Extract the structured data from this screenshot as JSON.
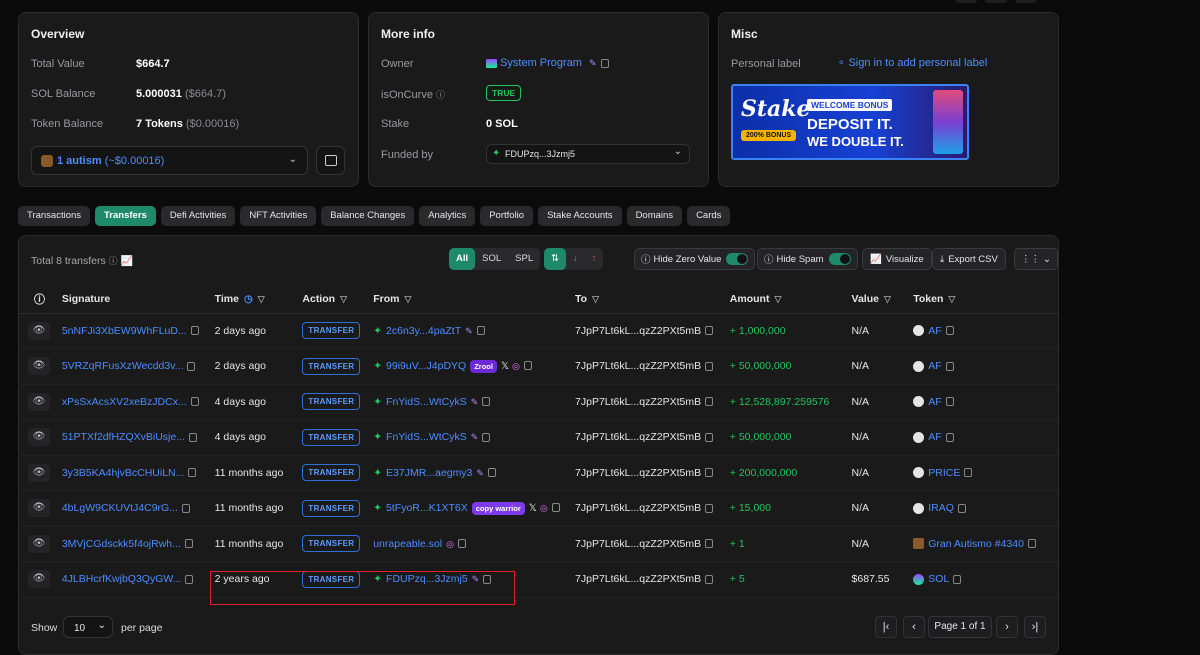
{
  "overview": {
    "title": "Overview",
    "total_value_label": "Total Value",
    "total_value": "$664.7",
    "sol_balance_label": "SOL Balance",
    "sol_balance": "5.000031",
    "sol_balance_usd": "($664.7)",
    "token_balance_label": "Token Balance",
    "token_balance": "7 Tokens",
    "token_balance_usd": "($0.00016)",
    "token_select_value": "1 autism",
    "token_select_usd": "(~$0.00016)"
  },
  "moreinfo": {
    "title": "More info",
    "owner_label": "Owner",
    "owner": "System Program",
    "oncurve_label": "isOnCurve",
    "oncurve": "TRUE",
    "stake_label": "Stake",
    "stake": "0 SOL",
    "funded_label": "Funded by",
    "funded": "FDUPzq...3Jzmj5"
  },
  "misc": {
    "title": "Misc",
    "personal_label": "Personal label",
    "signin_link": "Sign in to add personal label",
    "ad": {
      "brand": "Stake",
      "bonus_pill": "200% BONUS",
      "headline1": "WELCOME BONUS",
      "headline2": "DEPOSIT IT.",
      "headline3": "WE DOUBLE IT."
    }
  },
  "tabs": [
    "Transactions",
    "Transfers",
    "Defi Activities",
    "NFT Activities",
    "Balance Changes",
    "Analytics",
    "Portfolio",
    "Stake Accounts",
    "Domains",
    "Cards"
  ],
  "toolbar": {
    "total": "Total 8 transfers",
    "all": "All",
    "sol": "SOL",
    "spl": "SPL",
    "hide_zero": "Hide Zero Value",
    "hide_spam": "Hide Spam",
    "visualize": "Visualize",
    "export": "Export CSV"
  },
  "columns": [
    "Signature",
    "Time",
    "Action",
    "From",
    "To",
    "Amount",
    "Value",
    "Token"
  ],
  "rows": [
    {
      "sig": "5nNFJi3XbEW9WhFLuD...",
      "time": "2 days ago",
      "action": "TRANSFER",
      "from": "2c6n3y...4paZtT",
      "from_chip": "",
      "to": "7JpP7Lt6kL...qzZ2PXt5mB",
      "amount": "+ 1,000,000",
      "value": "N/A",
      "token": "AF"
    },
    {
      "sig": "5VRZqRFusXzWecdd3v...",
      "time": "2 days ago",
      "action": "TRANSFER",
      "from": "99i9uV...J4pDYQ",
      "from_chip": "Zrool",
      "to": "7JpP7Lt6kL...qzZ2PXt5mB",
      "amount": "+ 50,000,000",
      "value": "N/A",
      "token": "AF"
    },
    {
      "sig": "xPsSxAcsXV2xeBzJDCx...",
      "time": "4 days ago",
      "action": "TRANSFER",
      "from": "FnYidS...WtCykS",
      "from_chip": "",
      "to": "7JpP7Lt6kL...qzZ2PXt5mB",
      "amount": "+ 12,528,897.259576",
      "value": "N/A",
      "token": "AF"
    },
    {
      "sig": "51PTXf2dfHZQXvBiUsje...",
      "time": "4 days ago",
      "action": "TRANSFER",
      "from": "FnYidS...WtCykS",
      "from_chip": "",
      "to": "7JpP7Lt6kL...qzZ2PXt5mB",
      "amount": "+ 50,000,000",
      "value": "N/A",
      "token": "AF"
    },
    {
      "sig": "3y3B5KA4hjvBcCHUiLN...",
      "time": "11 months ago",
      "action": "TRANSFER",
      "from": "E37JMR...aegmy3",
      "from_chip": "",
      "to": "7JpP7Lt6kL...qzZ2PXt5mB",
      "amount": "+ 200,000,000",
      "value": "N/A",
      "token": "PRICE"
    },
    {
      "sig": "4bLgW9CKUVtJ4C9rG...",
      "time": "11 months ago",
      "action": "TRANSFER",
      "from": "5tFyoR...K1XT6X",
      "from_chip": "copy warrior",
      "to": "7JpP7Lt6kL...qzZ2PXt5mB",
      "amount": "+ 15,000",
      "value": "N/A",
      "token": "IRAQ"
    },
    {
      "sig": "3MVjCGdsckk5f4ojRwh...",
      "time": "11 months ago",
      "action": "TRANSFER",
      "from": "unrapeable.sol",
      "from_chip": "",
      "to": "7JpP7Lt6kL...qzZ2PXt5mB",
      "amount": "+ 1",
      "value": "N/A",
      "token": "Gran Autismo #4340"
    },
    {
      "sig": "4JLBHcrfKwjbQ3QyGW...",
      "time": "2 years ago",
      "action": "TRANSFER",
      "from": "FDUPzq...3Jzmj5",
      "from_chip": "",
      "to": "7JpP7Lt6kL...qzZ2PXt5mB",
      "amount": "+ 5",
      "value": "$687.55",
      "token": "SOL"
    }
  ],
  "footer": {
    "show": "Show",
    "per_page_value": "10",
    "per_page": "per page",
    "page": "Page 1 of 1"
  }
}
